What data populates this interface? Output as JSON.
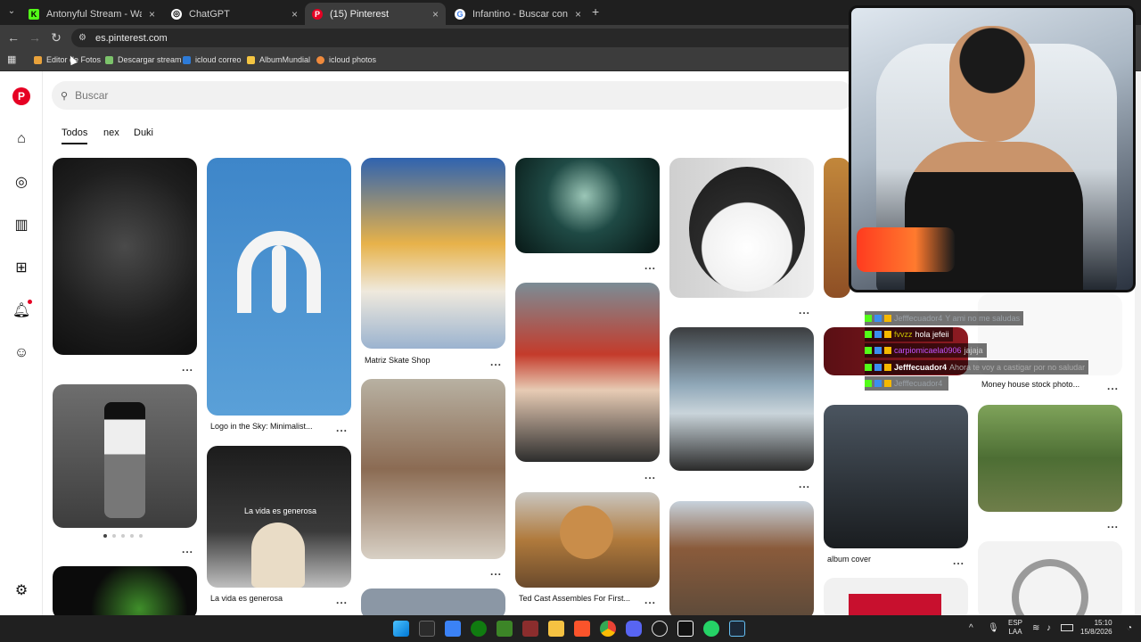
{
  "browser": {
    "tabs": [
      {
        "title": "Antonyful Stream - Watch Live",
        "icon": "kick-icon",
        "color": "#53fc18"
      },
      {
        "title": "ChatGPT",
        "icon": "chatgpt-icon",
        "color": "#ffffff"
      },
      {
        "title": "(15) Pinterest",
        "icon": "pinterest-icon",
        "color": "#e60023"
      },
      {
        "title": "Infantino - Buscar con Google",
        "icon": "google-icon",
        "color": "#4285f4"
      }
    ],
    "url": "es.pinterest.com",
    "bookmarks": [
      {
        "label": "Editor de Fotos",
        "color": "#e9a23b"
      },
      {
        "label": "Descargar stream",
        "color": "#7cc36b"
      },
      {
        "label": "icloud correo",
        "color": "#2d7bd8"
      },
      {
        "label": "AlbumMundial",
        "color": "#f4c542"
      },
      {
        "label": "icloud photos",
        "color": "#f08a3c"
      }
    ]
  },
  "pinterest": {
    "brand_color": "#e60023",
    "search_placeholder": "Buscar",
    "chips": [
      "Todos",
      "nex",
      "Duki"
    ],
    "captions": {
      "c2": "Logo in the Sky: Minimalist...",
      "c3": "Matriz Skate Shop",
      "c3b": "La vida es generosa",
      "c4": "Ted Cast Assembles For First...",
      "c6": "album cover",
      "c7": "Money house stock photo...",
      "pin_text": "La vida es generosa"
    },
    "more": "..."
  },
  "chat": [
    {
      "user": "Jefffecuador4",
      "msg": "Y ami no me saludas",
      "color": "#9aa0a6"
    },
    {
      "user": "fvvzz",
      "msg": "hola jefeii",
      "color": "#c6c000"
    },
    {
      "user": "carpiomicaela0906",
      "msg": "jajaja",
      "color": "#c054ff"
    },
    {
      "user": "Jefffecuador4",
      "msg": "Ahora te voy a castigar por no saludar",
      "color": "#ffffff"
    },
    {
      "user": "Jefffecuador4",
      "msg": "",
      "color": "#9aa0a6"
    }
  ],
  "system": {
    "lang": "ESP",
    "layout": "LAA",
    "time": "15:10",
    "date": "15/8/2026"
  }
}
